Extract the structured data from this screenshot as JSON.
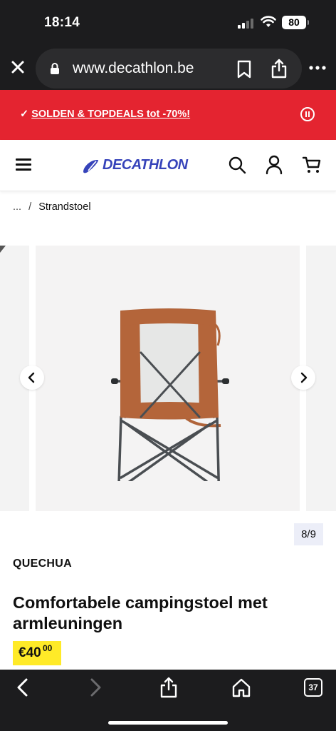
{
  "status_bar": {
    "time": "18:14",
    "battery": "80"
  },
  "browser": {
    "url": "www.decathlon.be",
    "icons": [
      "close-icon",
      "lock-icon",
      "bookmark-icon",
      "share-icon",
      "more-icon"
    ]
  },
  "promo": {
    "check": "✓",
    "text": "SOLDEN & TOPDEALS tot -70%!",
    "background": "#e42430"
  },
  "header": {
    "logo_text": "DECATHLON",
    "logo_color": "#3643ba",
    "icons": [
      "menu-icon",
      "search-icon",
      "account-icon",
      "cart-icon"
    ]
  },
  "breadcrumb": {
    "ellipsis": "...",
    "separator": "/",
    "current": "Strandstoel"
  },
  "gallery": {
    "counter": "8/9",
    "current_index": 8,
    "total": 9
  },
  "product": {
    "brand": "QUECHUA",
    "title": "Comfortabele campingstoel met armleuningen",
    "price_main": "€40",
    "price_cents": "00",
    "price_color": "#ffea28"
  },
  "toolbar": {
    "tabs_count": "37",
    "icons": [
      "back-icon",
      "forward-icon",
      "share-icon",
      "home-icon",
      "tabs-icon"
    ]
  }
}
